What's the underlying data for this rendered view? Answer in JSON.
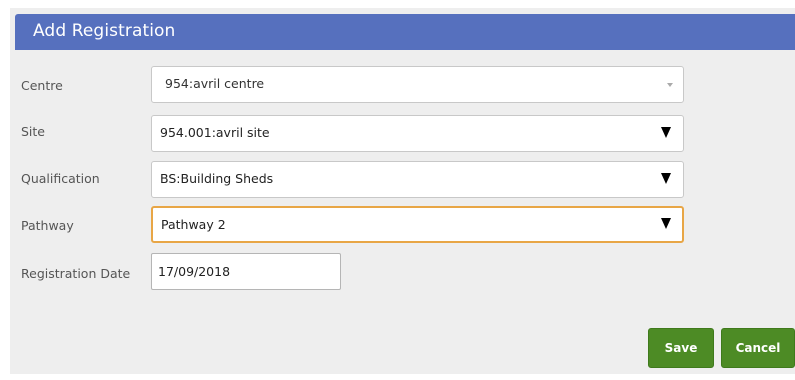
{
  "dialog": {
    "title": "Add Registration"
  },
  "form": {
    "centre": {
      "label": "Centre",
      "value": "954:avril centre"
    },
    "site": {
      "label": "Site",
      "value": "954.001:avril site"
    },
    "qualification": {
      "label": "Qualification",
      "value": "BS:Building Sheds"
    },
    "pathway": {
      "label": "Pathway",
      "value": "Pathway 2"
    },
    "registration_date": {
      "label": "Registration Date",
      "value": "17/09/2018"
    }
  },
  "actions": {
    "save_label": "Save",
    "cancel_label": "Cancel"
  },
  "colors": {
    "header_bg": "#5670be",
    "button_bg": "#4d8b25",
    "focus_border": "#e8a646",
    "panel_bg": "#eeeeee"
  }
}
